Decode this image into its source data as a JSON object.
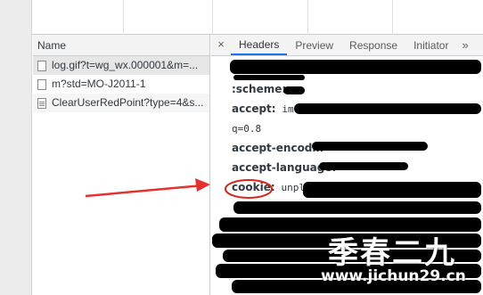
{
  "network": {
    "column_header": "Name",
    "requests": [
      {
        "name": "log.gif?t=wg_wx.000001&m=..."
      },
      {
        "name": "m?std=MO-J2011-1"
      },
      {
        "name": "ClearUserRedPoint?type=4&s..."
      }
    ]
  },
  "detail": {
    "close_glyph": "×",
    "tabs": [
      "Headers",
      "Preview",
      "Response",
      "Initiator"
    ],
    "more_glyph": "»",
    "active_tab": "Headers",
    "headers": [
      {
        "name": "",
        "value": ""
      },
      {
        "name": ":scheme:",
        "value": ""
      },
      {
        "name": "accept:",
        "value": "im"
      },
      {
        "name": "",
        "value": "q=0.8"
      },
      {
        "name": "accept-encodin",
        "value": ""
      },
      {
        "name": "accept-language:",
        "value": ""
      },
      {
        "name": "cookie:",
        "value": "unpl=V"
      }
    ]
  },
  "annotation": {
    "arrow_color": "#e8312f",
    "circle_color": "#d9261c"
  },
  "watermark": {
    "text": "季春二九",
    "url": "www.jichun29.cn"
  }
}
